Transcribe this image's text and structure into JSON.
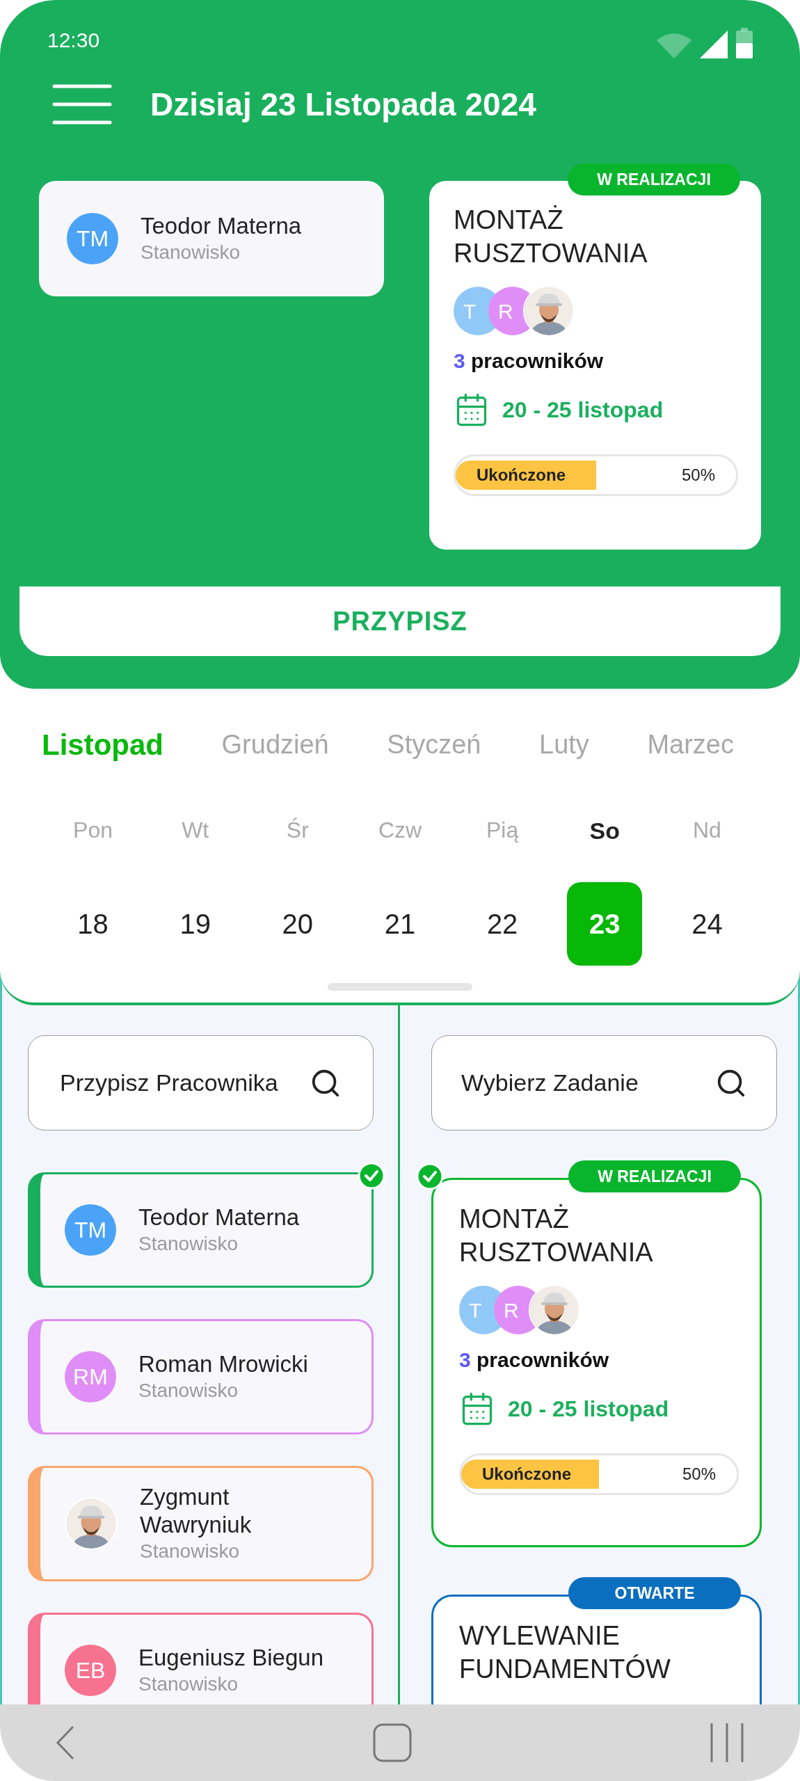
{
  "status_bar": {
    "time": "12:30"
  },
  "header": {
    "title": "Dzisiaj 23 Listopada 2024"
  },
  "assignment": {
    "worker": {
      "name": "Teodor Materna",
      "position": "Stanowisko",
      "initials": "TM",
      "color": "#4aa3f7"
    },
    "task": {
      "status": "W REALIZACJI",
      "color": "#0ab52e",
      "title": "MONTAŻ RUSZTOWANIA",
      "members": [
        {
          "kind": "initials",
          "initials": "T",
          "color": "#90c8f8"
        },
        {
          "kind": "initials",
          "initials": "R",
          "color": "#e08ef7"
        },
        {
          "kind": "picture"
        }
      ],
      "count": "3",
      "count_label": "pracowników",
      "dates": "20 - 25 listopad",
      "progress_label": "Ukończone",
      "level": 0.5,
      "reading": "50%"
    },
    "button": "PRZYPISZ"
  },
  "months": [
    {
      "label": "Listopad",
      "selected": true
    },
    {
      "label": "Grudzień",
      "selected": false
    },
    {
      "label": "Styczeń",
      "selected": false
    },
    {
      "label": "Luty",
      "selected": false
    },
    {
      "label": "Marzec",
      "selected": false
    }
  ],
  "weekdays": [
    {
      "label": "Pon",
      "selected": false
    },
    {
      "label": "Wt",
      "selected": false
    },
    {
      "label": "Śr",
      "selected": false
    },
    {
      "label": "Czw",
      "selected": false
    },
    {
      "label": "Pią",
      "selected": false
    },
    {
      "label": "So",
      "selected": true
    },
    {
      "label": "Nd",
      "selected": false
    }
  ],
  "days": [
    {
      "label": "18",
      "selected": false
    },
    {
      "label": "19",
      "selected": false
    },
    {
      "label": "20",
      "selected": false
    },
    {
      "label": "21",
      "selected": false
    },
    {
      "label": "22",
      "selected": false
    },
    {
      "label": "23",
      "selected": true
    },
    {
      "label": "24",
      "selected": false
    }
  ],
  "worker_search": {
    "placeholder": "Przypisz Pracownika"
  },
  "task_search": {
    "placeholder": "Wybierz Zadanie"
  },
  "workers": [
    {
      "kind": "initials",
      "name": "Teodor Materna",
      "position": "Stanowisko",
      "initials": "TM",
      "color": "#4aa3f7",
      "selected": true
    },
    {
      "kind": "initials",
      "name": "Roman Mrowicki",
      "position": "Stanowisko",
      "initials": "RM",
      "color": "#e08ef7",
      "selected": false
    },
    {
      "kind": "picture",
      "name": "Zygmunt Wawryniuk",
      "position": "Stanowisko",
      "color": "#f9a66c",
      "selected": false
    },
    {
      "kind": "initials",
      "name": "Eugeniusz Biegun",
      "position": "Stanowisko",
      "initials": "EB",
      "color": "#f7728f",
      "selected": false
    }
  ],
  "tasks": [
    {
      "status": "W REALIZACJI",
      "color": "#0ab52e",
      "selected": true,
      "title": "MONTAŻ RUSZTOWANIA",
      "members": [
        {
          "kind": "initials",
          "initials": "T",
          "color": "#90c8f8"
        },
        {
          "kind": "initials",
          "initials": "R",
          "color": "#e08ef7"
        },
        {
          "kind": "picture"
        }
      ],
      "count": "3",
      "count_label": "pracowników",
      "dates": "20 - 25 listopad",
      "progress_label": "Ukończone",
      "level": 0.5,
      "reading": "50%"
    },
    {
      "status": "OTWARTE",
      "color": "#0b6fbf",
      "selected": false,
      "title": "WYLEWANIE FUNDAMENTÓW"
    }
  ]
}
